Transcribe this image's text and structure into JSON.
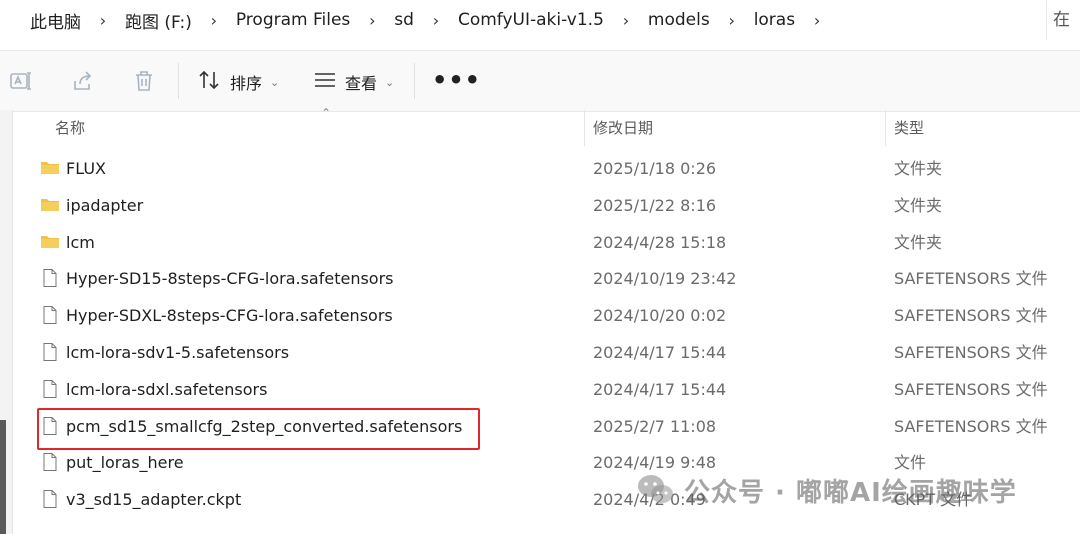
{
  "address_bar": {
    "breadcrumbs": [
      "此电脑",
      "跑图 (F:)",
      "Program Files",
      "sd",
      "ComfyUI-aki-v1.5",
      "models",
      "loras"
    ],
    "search_partial": "在"
  },
  "toolbar": {
    "sort_label": "排序",
    "view_label": "查看",
    "more_label": "•••"
  },
  "columns": {
    "name": "名称",
    "modified": "修改日期",
    "type": "类型"
  },
  "files": [
    {
      "name": "FLUX",
      "date": "2025/1/18 0:26",
      "type": "文件夹",
      "kind": "folder"
    },
    {
      "name": "ipadapter",
      "date": "2025/1/22 8:16",
      "type": "文件夹",
      "kind": "folder"
    },
    {
      "name": "lcm",
      "date": "2024/4/28 15:18",
      "type": "文件夹",
      "kind": "folder"
    },
    {
      "name": "Hyper-SD15-8steps-CFG-lora.safetensors",
      "date": "2024/10/19 23:42",
      "type": "SAFETENSORS 文件",
      "kind": "file"
    },
    {
      "name": "Hyper-SDXL-8steps-CFG-lora.safetensors",
      "date": "2024/10/20 0:02",
      "type": "SAFETENSORS 文件",
      "kind": "file"
    },
    {
      "name": "lcm-lora-sdv1-5.safetensors",
      "date": "2024/4/17 15:44",
      "type": "SAFETENSORS 文件",
      "kind": "file"
    },
    {
      "name": "lcm-lora-sdxl.safetensors",
      "date": "2024/4/17 15:44",
      "type": "SAFETENSORS 文件",
      "kind": "file"
    },
    {
      "name": "pcm_sd15_smallcfg_2step_converted.safetensors",
      "date": "2025/2/7 11:08",
      "type": "SAFETENSORS 文件",
      "kind": "file"
    },
    {
      "name": "put_loras_here",
      "date": "2024/4/19 9:48",
      "type": "文件",
      "kind": "file"
    },
    {
      "name": "v3_sd15_adapter.ckpt",
      "date": "2024/4/2 0:49",
      "type": "CKPT 文件",
      "kind": "file"
    }
  ],
  "watermark": {
    "text": "公众号 · 嘟嘟AI绘画趣味学"
  },
  "colors": {
    "folder": "#f0c24a",
    "highlight": "#e0282c"
  }
}
